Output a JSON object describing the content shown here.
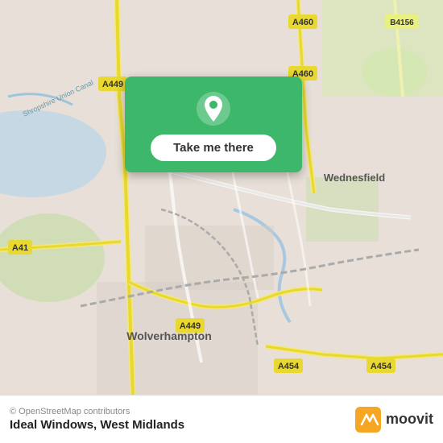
{
  "map": {
    "attribution": "© OpenStreetMap contributors",
    "location_name": "Ideal Windows, West Midlands",
    "button_label": "Take me there",
    "center_lat": 52.59,
    "center_lng": -2.12,
    "road_labels": [
      "A460",
      "B4156",
      "A449",
      "A449",
      "A41",
      "A449",
      "A454",
      "A454",
      "Wednesfield",
      "Wolverhampton"
    ],
    "bg_color": "#e8e0d8"
  },
  "footer": {
    "copyright": "© OpenStreetMap contributors",
    "location": "Ideal Windows, West Midlands",
    "moovit_label": "moovit"
  },
  "icons": {
    "pin": "location-pin-icon",
    "moovit_logo": "moovit-logo-icon"
  }
}
